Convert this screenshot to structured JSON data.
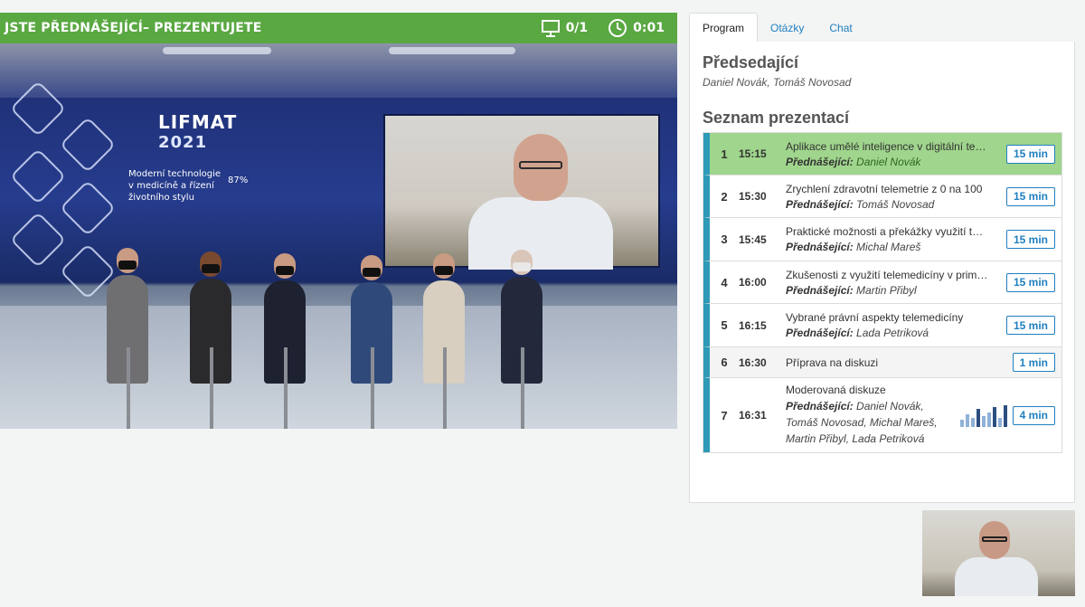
{
  "status_bar": {
    "status_text": "JSTE PŘEDNÁŠEJÍCÍ– PREZENTUJETE",
    "slide_counter": "0/1",
    "elapsed_time": "0:01",
    "bg_color": "#5aa842"
  },
  "tabs": [
    {
      "label": "Program",
      "active": true
    },
    {
      "label": "Otázky",
      "active": false
    },
    {
      "label": "Chat",
      "active": false
    }
  ],
  "chair": {
    "title": "Předsedající",
    "names": "Daniel Novák, Tomáš Novosad"
  },
  "presentations": {
    "title": "Seznam prezentací",
    "speaker_label": "Přednášející:",
    "items": [
      {
        "num": "1",
        "time": "15:15",
        "title": "Aplikace umělé inteligence v digitální terapii",
        "speakers": "Daniel Novák",
        "duration": "15 min",
        "state": "active"
      },
      {
        "num": "2",
        "time": "15:30",
        "title": "Zrychlení zdravotní telemetrie z 0 na 100",
        "speakers": "Tomáš Novosad",
        "duration": "15 min",
        "state": "normal"
      },
      {
        "num": "3",
        "time": "15:45",
        "title": "Praktické možnosti a překážky využití telemedicíny",
        "speakers": "Michal Mareš",
        "duration": "15 min",
        "state": "normal"
      },
      {
        "num": "4",
        "time": "16:00",
        "title": "Zkušenosti z využití telemedicíny v primární péči",
        "speakers": "Martin Přibyl",
        "duration": "15 min",
        "state": "normal"
      },
      {
        "num": "5",
        "time": "16:15",
        "title": "Vybrané právní aspekty telemedicíny",
        "speakers": "Lada Petriková",
        "duration": "15 min",
        "state": "normal"
      },
      {
        "num": "6",
        "time": "16:30",
        "title": "Příprava na diskuzi",
        "speakers": "",
        "duration": "1 min",
        "state": "plain"
      },
      {
        "num": "7",
        "time": "16:31",
        "title": "Moderovaná diskuze",
        "speakers": "Daniel Novák, Tomáš Novosad, Michal Mareš, Martin Přibyl, Lada Petriková",
        "duration": "4 min",
        "state": "normal",
        "has_poll": true
      }
    ]
  },
  "stage": {
    "logo": "LIFMAT",
    "logo_year": "2021",
    "slogan": "Moderní technologie v medicíně a řízení životního stylu",
    "percent": "87%"
  },
  "colors": {
    "link": "#1f7fc0",
    "active_row": "#9fd58c",
    "row_accent": "#2e9ab8"
  }
}
